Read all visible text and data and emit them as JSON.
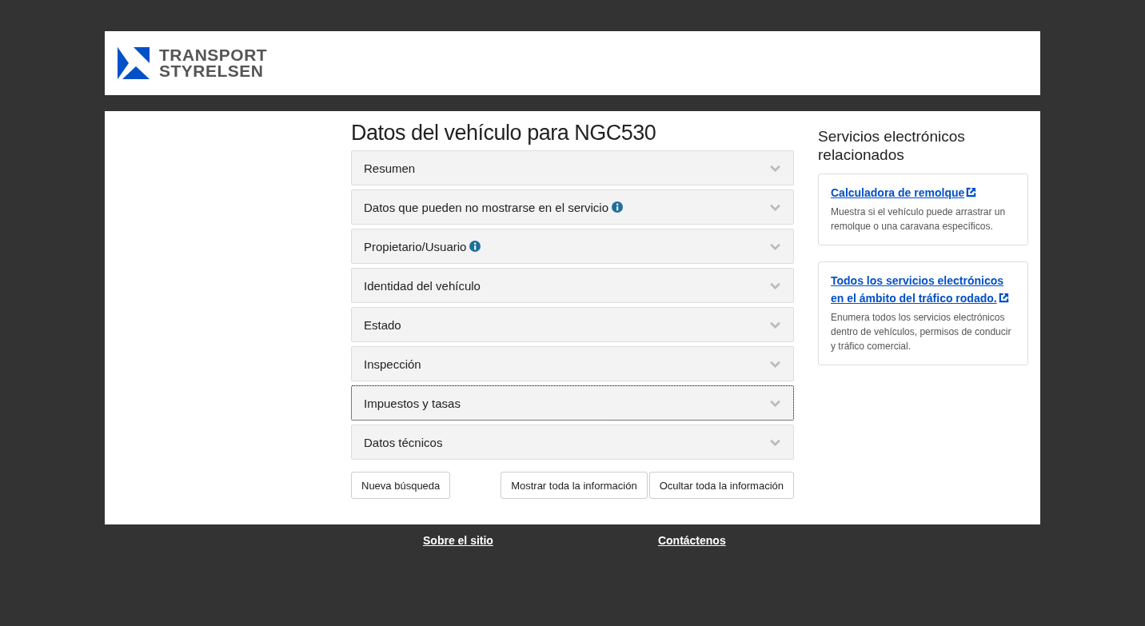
{
  "header": {
    "logo_lines": [
      "TRANSPORT",
      "STYRELSEN"
    ]
  },
  "main": {
    "title": "Datos del vehículo para NGC530",
    "sections": [
      {
        "label": "Resumen",
        "info": false,
        "expanded": false,
        "focused": false
      },
      {
        "label": "Datos que pueden no mostrarse en el servicio",
        "info": true,
        "expanded": false,
        "focused": false
      },
      {
        "label": "Propietario/Usuario",
        "info": true,
        "expanded": false,
        "focused": false
      },
      {
        "label": "Identidad del vehículo",
        "info": false,
        "expanded": false,
        "focused": false
      },
      {
        "label": "Estado",
        "info": false,
        "expanded": false,
        "focused": false
      },
      {
        "label": "Inspección",
        "info": false,
        "expanded": false,
        "focused": false
      },
      {
        "label": "Impuestos y tasas",
        "info": false,
        "expanded": false,
        "focused": true
      },
      {
        "label": "Datos técnicos",
        "info": false,
        "expanded": false,
        "focused": false
      }
    ],
    "buttons": {
      "new_search": "Nueva búsqueda",
      "show_all": "Mostrar toda la información",
      "hide_all": "Ocultar toda la información"
    }
  },
  "sidebar": {
    "title": "Servicios electrónicos relacionados",
    "cards": [
      {
        "link": "Calculadora de remolque",
        "description": "Muestra si el vehículo puede arrastrar un remolque o una caravana específicos."
      },
      {
        "link": "Todos los servicios electrónicos en el ámbito del tráfico rodado.",
        "description": "Enumera todos los servicios electrónicos dentro de vehículos, permisos de conducir y tráfico comercial."
      }
    ]
  },
  "footer": {
    "links": [
      "Sobre el sitio",
      "Contáctenos"
    ]
  }
}
